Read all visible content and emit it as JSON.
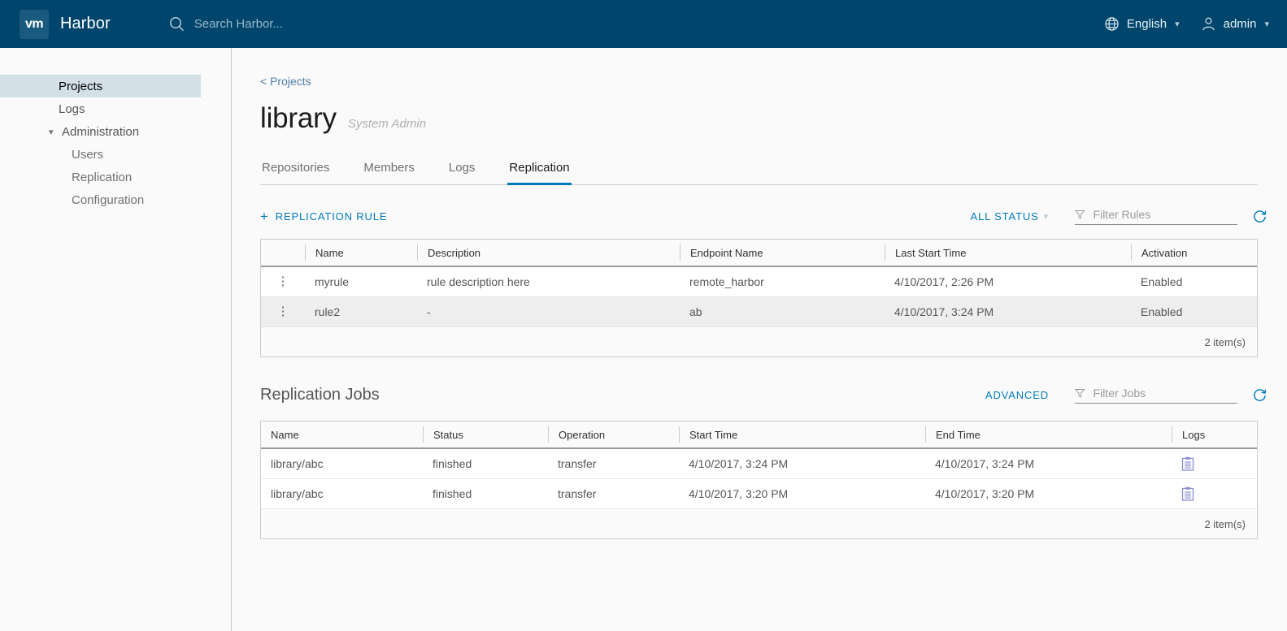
{
  "header": {
    "logo_text": "vm",
    "brand": "Harbor",
    "search_placeholder": "Search Harbor...",
    "search_value": "",
    "language": "English",
    "user": "admin"
  },
  "sidebar": {
    "items": [
      {
        "label": "Projects",
        "active": true
      },
      {
        "label": "Logs",
        "active": false
      }
    ],
    "group": {
      "label": "Administration",
      "expanded": true
    },
    "sub_items": [
      {
        "label": "Users"
      },
      {
        "label": "Replication"
      },
      {
        "label": "Configuration"
      }
    ]
  },
  "breadcrumb": "< Projects",
  "page": {
    "title": "library",
    "role": "System Admin"
  },
  "tabs": [
    {
      "label": "Repositories",
      "active": false
    },
    {
      "label": "Members",
      "active": false
    },
    {
      "label": "Logs",
      "active": false
    },
    {
      "label": "Replication",
      "active": true
    }
  ],
  "rules_toolbar": {
    "new_rule_label": "REPLICATION RULE",
    "status_filter": "ALL STATUS",
    "filter_placeholder": "Filter Rules",
    "filter_value": "",
    "refresh_icon": "refresh-icon",
    "filter_icon": "funnel-icon",
    "plus_icon": "plus-icon"
  },
  "rules_table": {
    "columns": [
      "",
      "Name",
      "Description",
      "Endpoint Name",
      "Last Start Time",
      "Activation"
    ],
    "rows": [
      {
        "menu": "kebab-menu-icon",
        "name": "myrule",
        "description": "rule description here",
        "endpoint": "remote_harbor",
        "last_start": "4/10/2017, 2:26 PM",
        "activation": "Enabled"
      },
      {
        "menu": "kebab-menu-icon",
        "name": "rule2",
        "description": "-",
        "endpoint": "ab",
        "last_start": "4/10/2017, 3:24 PM",
        "activation": "Enabled"
      }
    ],
    "footer": "2 item(s)"
  },
  "jobs_section": {
    "title": "Replication Jobs",
    "advanced_label": "ADVANCED",
    "filter_placeholder": "Filter Jobs",
    "filter_value": ""
  },
  "jobs_table": {
    "columns": [
      "Name",
      "Status",
      "Operation",
      "Start Time",
      "End Time",
      "Logs"
    ],
    "rows": [
      {
        "name": "library/abc",
        "status": "finished",
        "operation": "transfer",
        "start_time": "4/10/2017, 3:24 PM",
        "end_time": "4/10/2017, 3:24 PM",
        "logs_icon": "clipboard-logs-icon"
      },
      {
        "name": "library/abc",
        "status": "finished",
        "operation": "transfer",
        "start_time": "4/10/2017, 3:20 PM",
        "end_time": "4/10/2017, 3:20 PM",
        "logs_icon": "clipboard-logs-icon"
      }
    ],
    "footer": "2 item(s)"
  },
  "colors": {
    "header_bg": "#00456b",
    "accent": "#0079b8",
    "active_nav_bg": "#d3e0e8",
    "logs_icon": "#8a8fd4"
  }
}
